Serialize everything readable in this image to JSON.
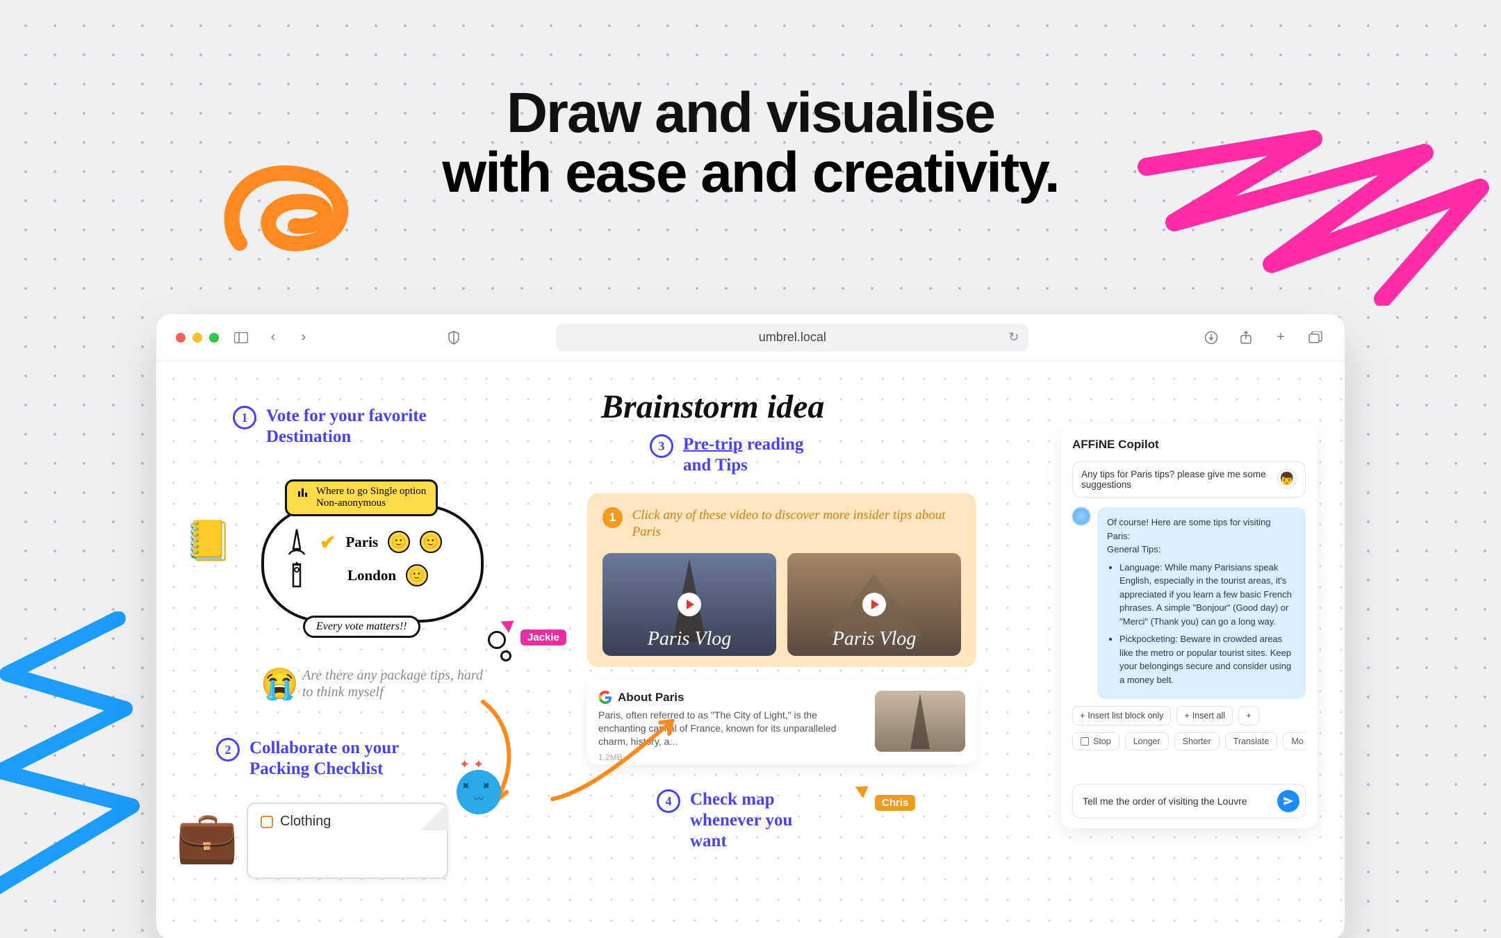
{
  "hero": {
    "line1": "Draw and visualise",
    "line2": "with ease and creativity."
  },
  "browser": {
    "url": "umbrel.local"
  },
  "canvas": {
    "title": "Brainstorm idea",
    "step1": {
      "num": "1",
      "label": "Vote for your favorite Destination"
    },
    "poll": {
      "header_line1": "Where to go Single option",
      "header_line2": "Non-anonymous",
      "optionA": "Paris",
      "optionB": "London",
      "footer": "Every vote matters!!"
    },
    "cry_text": "Are there any package tips, hard to think myself",
    "step2": {
      "num": "2",
      "label": "Collaborate on your Packing Checklist"
    },
    "doc": {
      "item1": "Clothing"
    },
    "step3": {
      "num": "3",
      "label_underlined": "Pre-trip",
      "label_rest": " reading and Tips"
    },
    "tip": {
      "badge": "1",
      "lead": "Click any of these video to discover more insider tips about Paris",
      "video1": "Paris Vlog",
      "video2": "Paris Vlog"
    },
    "about": {
      "title": "About Paris",
      "body": "Paris, often referred to as \"The City of Light,\" is the enchanting capital of France, known for its unparalleled charm, history, a...",
      "size": "1.2MB"
    },
    "step4": {
      "num": "4",
      "label": "Check map whenever you want"
    },
    "cursors": {
      "jackie": "Jackie",
      "chris": "Chris"
    }
  },
  "copilot": {
    "title": "AFFiNE Copilot",
    "user_question": "Any tips for Paris tips? please give me some suggestions",
    "answer_intro": "Of course! Here are some tips for visiting Paris:",
    "answer_subhead": "General Tips:",
    "bullets": [
      "Language: While many Parisians speak English, especially in the tourist areas, it's appreciated if you learn a few basic French phrases. A simple \"Bonjour\" (Good day) or \"Merci\" (Thank you) can go a long way.",
      "Pickpocketing: Beware in crowded areas like the metro or popular tourist sites. Keep your belongings secure and consider using a money belt."
    ],
    "actions": {
      "insert_list": "Insert list block only",
      "insert_all": "Insert all"
    },
    "pills": {
      "stop": "Stop",
      "longer": "Longer",
      "shorter": "Shorter",
      "translate": "Translate",
      "more": "Mo"
    },
    "prompt_value": "Tell me the order of visiting the Louvre"
  }
}
